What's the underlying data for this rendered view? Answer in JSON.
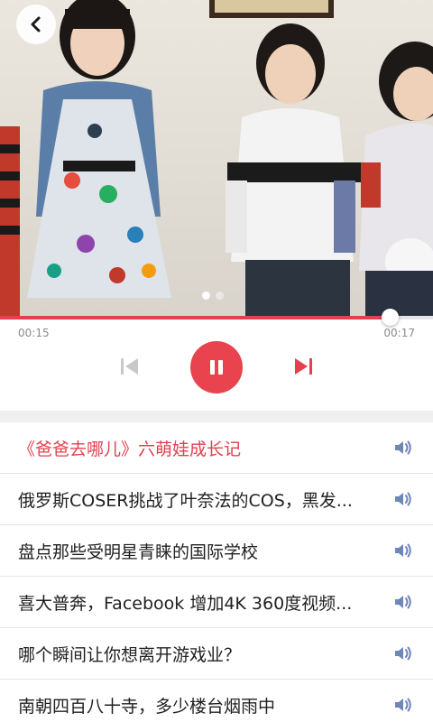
{
  "player": {
    "elapsed": "00:15",
    "total": "00:17",
    "progress": 0.9,
    "carousel_count": 2,
    "carousel_active": 0
  },
  "colors": {
    "accent": "#e3414e",
    "speaker": "#6f86b8",
    "disabled": "#c8c8c8"
  },
  "icons": {
    "back": "chevron-left-icon",
    "prev": "skip-previous-icon",
    "pause": "pause-icon",
    "next": "skip-next-icon",
    "speaker": "speaker-icon"
  },
  "playlist": [
    {
      "title": "《爸爸去哪儿》六萌娃成长记",
      "active": true
    },
    {
      "title": "俄罗斯COSER挑战了叶奈法的COS，黑发...",
      "active": false
    },
    {
      "title": "盘点那些受明星青睐的国际学校",
      "active": false
    },
    {
      "title": "喜大普奔，Facebook 增加4K 360度视频...",
      "active": false
    },
    {
      "title": "哪个瞬间让你想离开游戏业？",
      "active": false
    },
    {
      "title": "南朝四百八十寺，多少楼台烟雨中",
      "active": false
    }
  ]
}
